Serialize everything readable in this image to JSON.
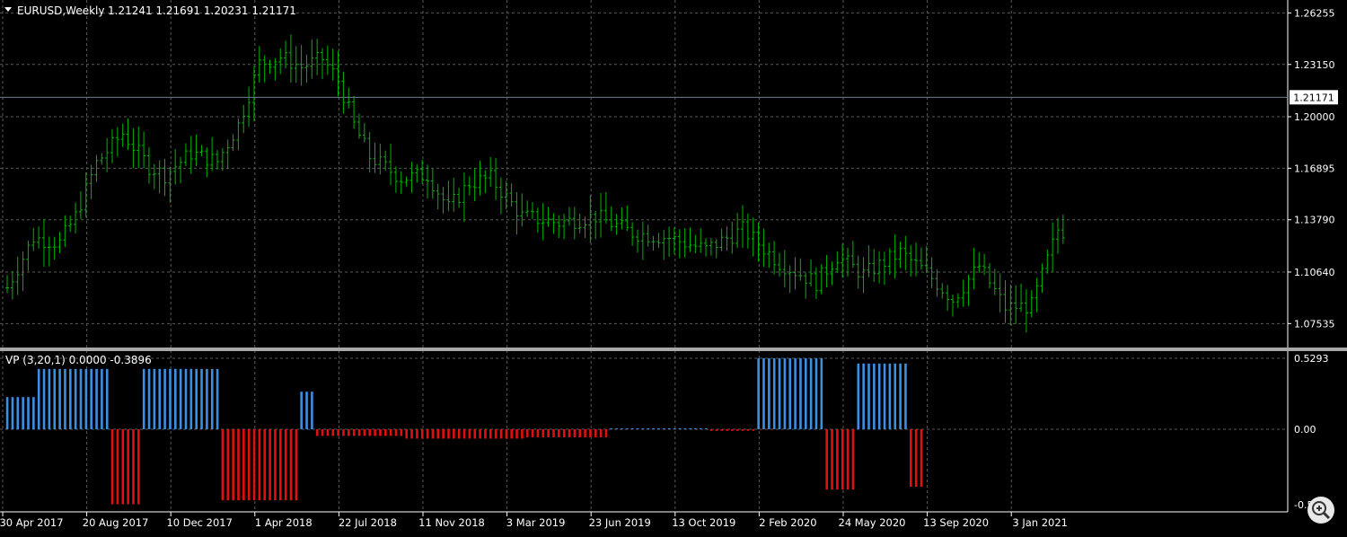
{
  "header": {
    "symbol_timeframe": "EURUSD,Weekly",
    "ohlc": "1.21241 1.21691 1.20231 1.21171"
  },
  "current_price_label": "1.21171",
  "indicator_header": "VP (3,20,1) 0.0000 -0.3896",
  "colors": {
    "background": "#000000",
    "grid": "#5a5a5a",
    "bar": "#00b400",
    "positive_histogram": "#3c8fe0",
    "negative_histogram": "#e01010",
    "current_price_line": "#6e7e94",
    "text": "#ffffff"
  },
  "chart_data": [
    {
      "type": "bar",
      "subtype": "ohlc",
      "symbol": "EURUSD",
      "timeframe": "Weekly",
      "price_ticks": [
        "1.26255",
        "1.23150",
        "1.20000",
        "1.16895",
        "1.13790",
        "1.10640",
        "1.07535"
      ],
      "ylim": [
        1.062,
        1.266
      ],
      "current_price": 1.21171,
      "grid": true,
      "x_labels": [
        "30 Apr 2017",
        "20 Aug 2017",
        "10 Dec 2017",
        "1 Apr 2018",
        "22 Jul 2018",
        "11 Nov 2018",
        "3 Mar 2019",
        "23 Jun 2019",
        "13 Oct 2019",
        "2 Feb 2020",
        "24 May 2020",
        "13 Sep 2020",
        "3 Jan 2021"
      ],
      "weeks_between_labels": 16,
      "bar_count": 202,
      "close_anchors": [
        [
          0,
          1.097
        ],
        [
          5,
          1.127
        ],
        [
          10,
          1.124
        ],
        [
          13,
          1.14
        ],
        [
          17,
          1.172
        ],
        [
          22,
          1.19
        ],
        [
          27,
          1.17
        ],
        [
          30,
          1.165
        ],
        [
          35,
          1.178
        ],
        [
          40,
          1.173
        ],
        [
          44,
          1.195
        ],
        [
          48,
          1.232
        ],
        [
          52,
          1.236
        ],
        [
          56,
          1.23
        ],
        [
          60,
          1.235
        ],
        [
          63,
          1.222
        ],
        [
          66,
          1.195
        ],
        [
          69,
          1.176
        ],
        [
          75,
          1.163
        ],
        [
          80,
          1.165
        ],
        [
          84,
          1.145
        ],
        [
          88,
          1.16
        ],
        [
          92,
          1.163
        ],
        [
          98,
          1.14
        ],
        [
          105,
          1.136
        ],
        [
          112,
          1.14
        ],
        [
          119,
          1.13
        ],
        [
          126,
          1.127
        ],
        [
          133,
          1.12
        ],
        [
          140,
          1.132
        ],
        [
          147,
          1.112
        ],
        [
          154,
          1.1
        ],
        [
          158,
          1.116
        ],
        [
          163,
          1.105
        ],
        [
          170,
          1.118
        ],
        [
          175,
          1.106
        ],
        [
          180,
          1.09
        ],
        [
          185,
          1.11
        ],
        [
          190,
          1.085
        ],
        [
          195,
          1.086
        ],
        [
          200,
          1.132
        ],
        [
          205,
          1.127
        ],
        [
          210,
          1.168
        ],
        [
          215,
          1.18
        ],
        [
          220,
          1.185
        ],
        [
          225,
          1.175
        ],
        [
          230,
          1.178
        ],
        [
          235,
          1.185
        ],
        [
          240,
          1.215
        ],
        [
          245,
          1.222
        ],
        [
          250,
          1.214
        ]
      ]
    },
    {
      "type": "bar",
      "subtype": "histogram",
      "name": "VP (3,20,1)",
      "value_ticks": [
        "0.5293",
        "0.00"
      ],
      "ylim": [
        -0.6,
        0.6
      ],
      "segments": [
        {
          "from": 0,
          "to": 5,
          "value": 0.24
        },
        {
          "from": 6,
          "to": 19,
          "value": 0.45
        },
        {
          "from": 20,
          "to": 25,
          "value": -0.56
        },
        {
          "from": 26,
          "to": 40,
          "value": 0.45
        },
        {
          "from": 41,
          "to": 55,
          "value": -0.53
        },
        {
          "from": 56,
          "to": 58,
          "value": 0.28
        },
        {
          "from": 59,
          "to": 75,
          "value": -0.05
        },
        {
          "from": 76,
          "to": 98,
          "value": -0.07
        },
        {
          "from": 99,
          "to": 114,
          "value": -0.06
        },
        {
          "from": 115,
          "to": 133,
          "value": 0.004
        },
        {
          "from": 134,
          "to": 142,
          "value": -0.012
        },
        {
          "from": 143,
          "to": 155,
          "value": 0.53
        },
        {
          "from": 156,
          "to": 161,
          "value": -0.45
        },
        {
          "from": 162,
          "to": 171,
          "value": 0.49
        },
        {
          "from": 172,
          "to": 174,
          "value": -0.43
        }
      ]
    }
  ]
}
